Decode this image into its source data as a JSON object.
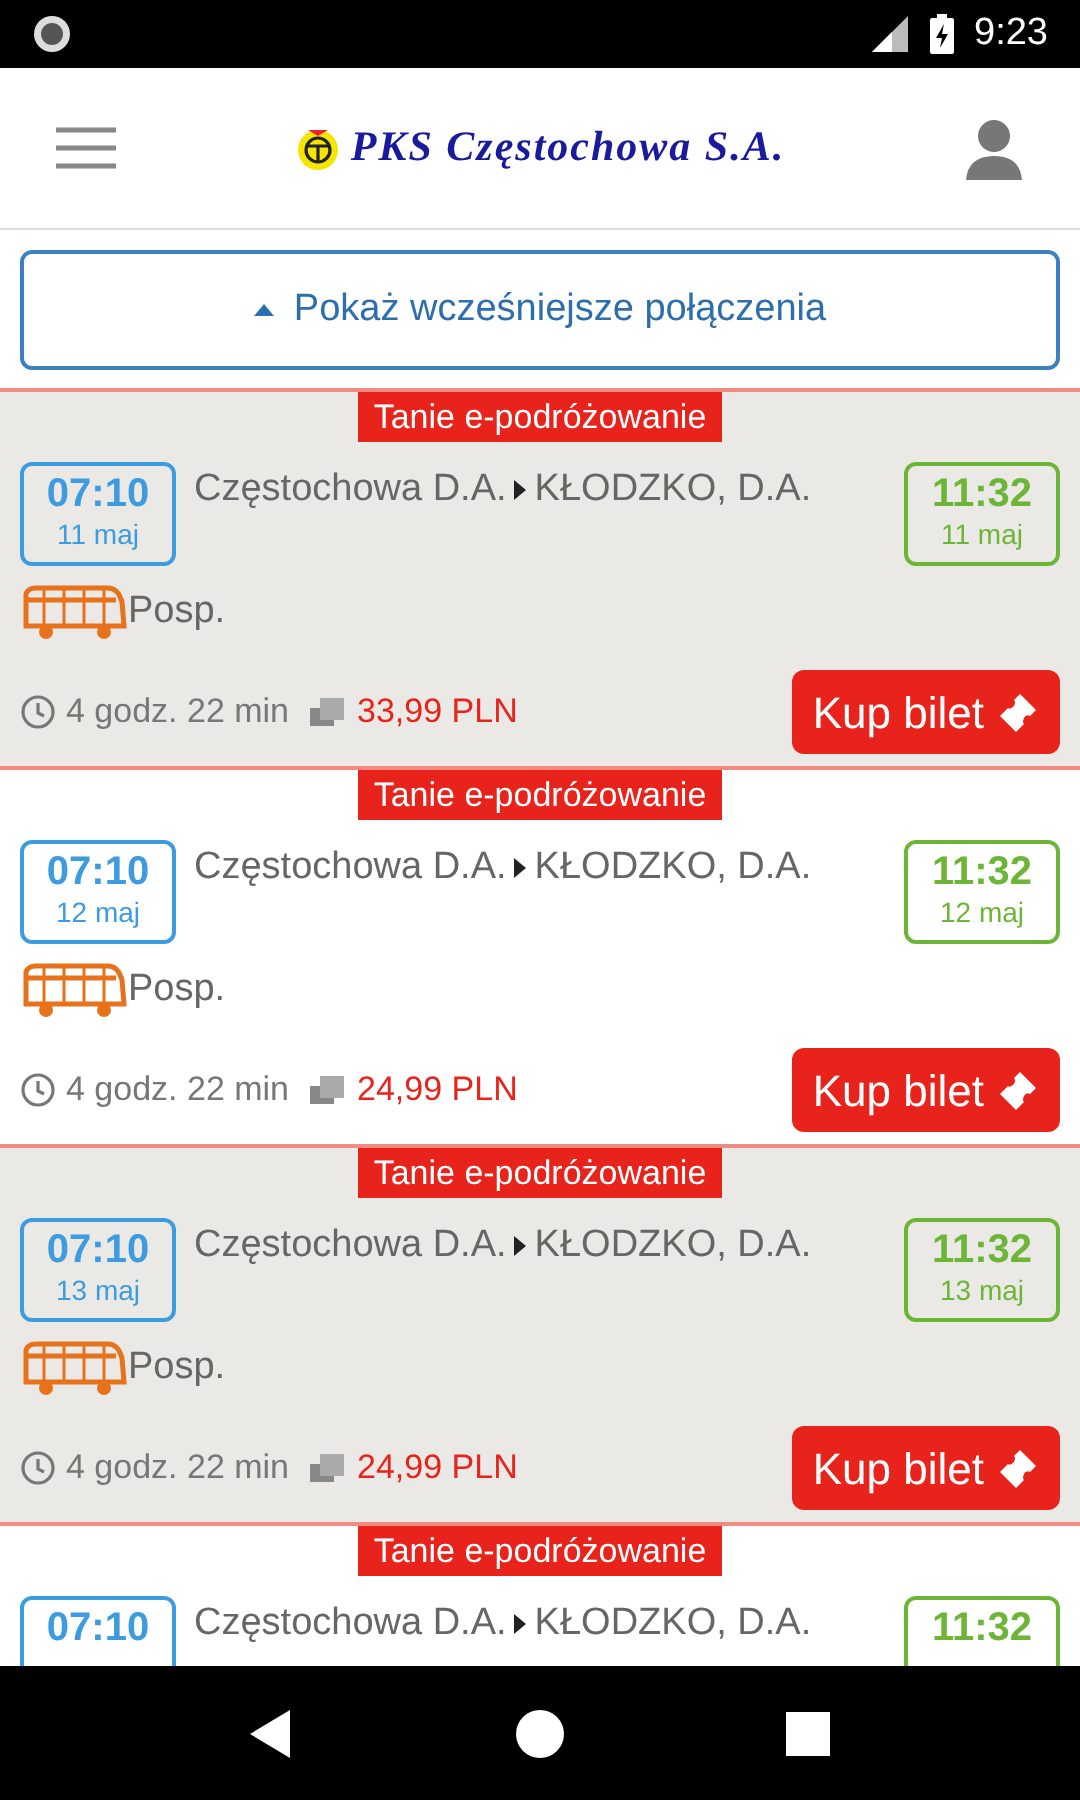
{
  "status_bar": {
    "time": "9:23"
  },
  "header": {
    "logo_text": "PKS Częstochowa S.A."
  },
  "earlier_button": {
    "label": "Pokaż wcześniejsze połączenia"
  },
  "connections": [
    {
      "badge": "Tanie e-podróżowanie",
      "shaded": true,
      "depart_time": "07:10",
      "depart_date": "11 maj",
      "route_from": "Częstochowa D.A.",
      "route_to": "KŁODZKO, D.A.",
      "arrive_time": "11:32",
      "arrive_date": "11 maj",
      "type": "Posp.",
      "duration": "4 godz. 22 min",
      "price": "33,99 PLN",
      "buy_label": "Kup bilet"
    },
    {
      "badge": "Tanie e-podróżowanie",
      "shaded": false,
      "depart_time": "07:10",
      "depart_date": "12 maj",
      "route_from": "Częstochowa D.A.",
      "route_to": "KŁODZKO, D.A.",
      "arrive_time": "11:32",
      "arrive_date": "12 maj",
      "type": "Posp.",
      "duration": "4 godz. 22 min",
      "price": "24,99 PLN",
      "buy_label": "Kup bilet"
    },
    {
      "badge": "Tanie e-podróżowanie",
      "shaded": true,
      "depart_time": "07:10",
      "depart_date": "13 maj",
      "route_from": "Częstochowa D.A.",
      "route_to": "KŁODZKO, D.A.",
      "arrive_time": "11:32",
      "arrive_date": "13 maj",
      "type": "Posp.",
      "duration": "4 godz. 22 min",
      "price": "24,99 PLN",
      "buy_label": "Kup bilet"
    },
    {
      "badge": "Tanie e-podróżowanie",
      "shaded": false,
      "depart_time": "07:10",
      "route_from": "Częstochowa D.A.",
      "route_to": "KŁODZKO, D.A.",
      "arrive_time": "11:32"
    }
  ]
}
